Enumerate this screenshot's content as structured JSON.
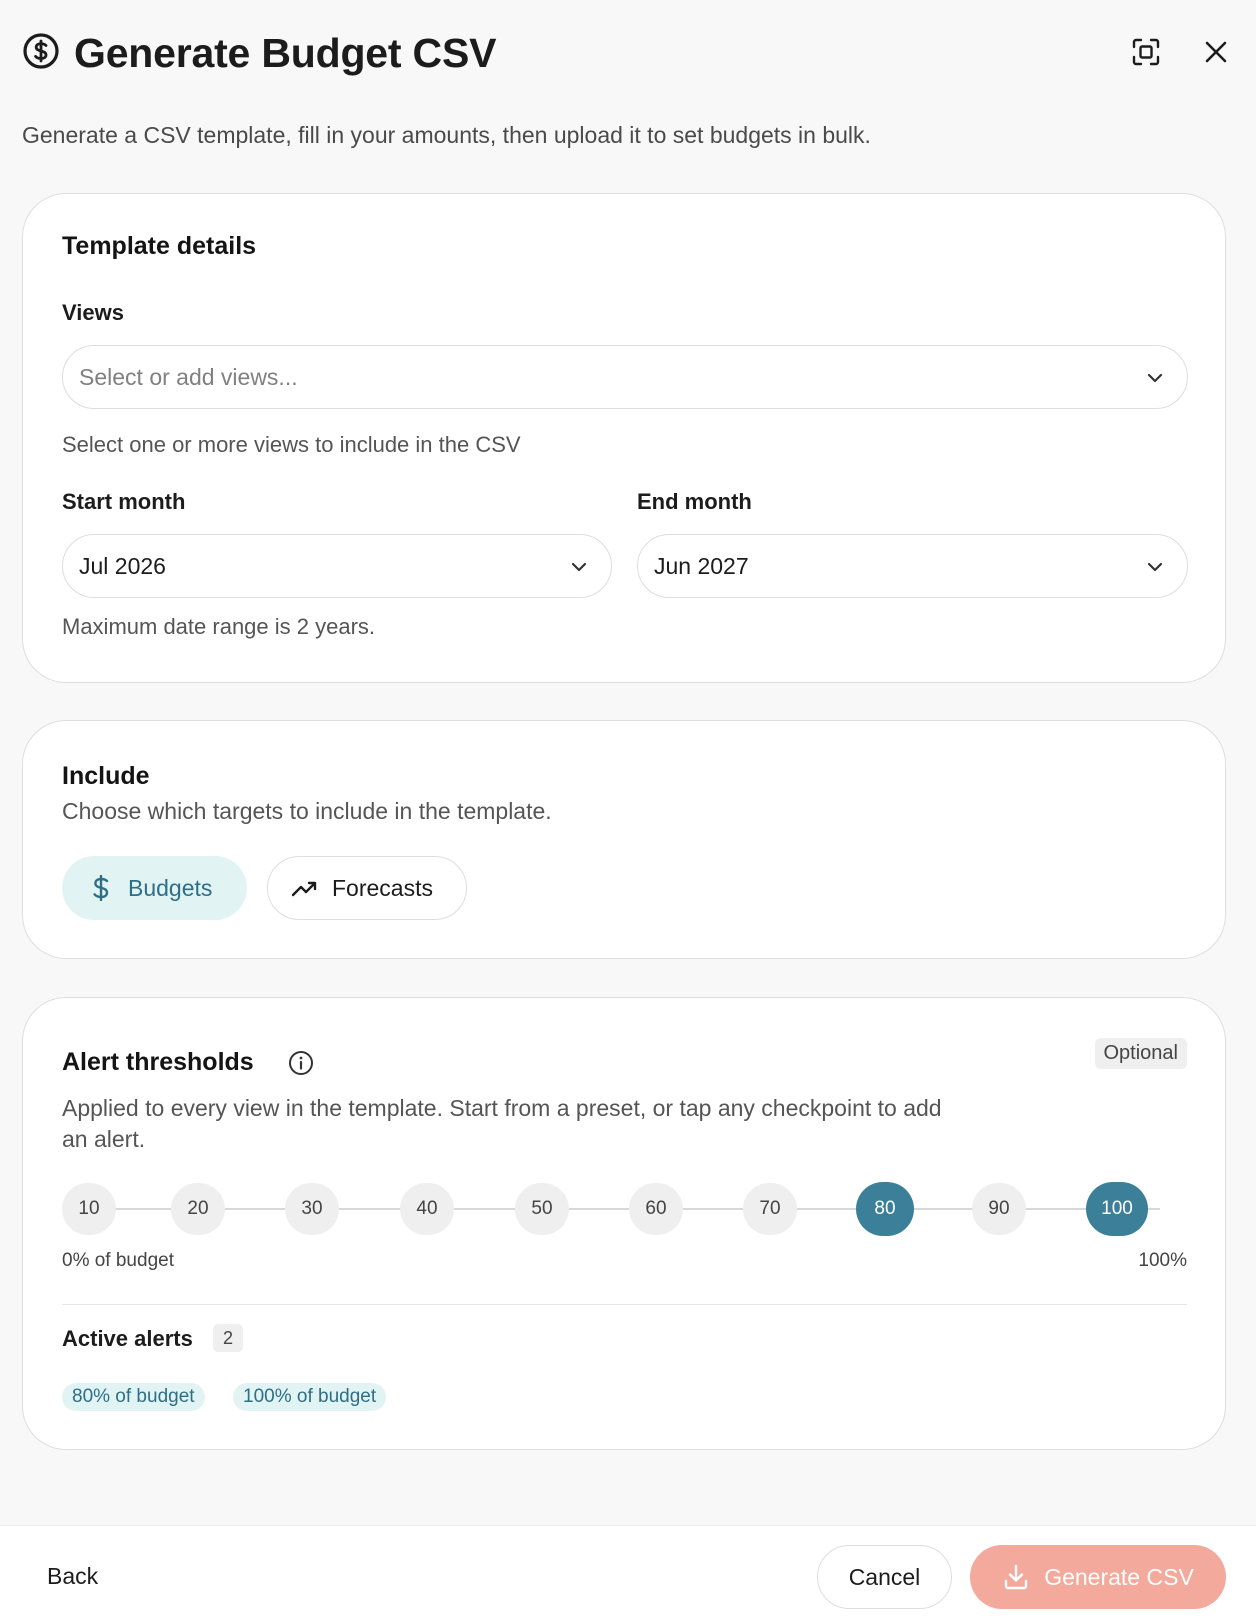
{
  "header": {
    "title": "Generate Budget CSV",
    "title_icon": "dollar-circle-icon",
    "fullscreen_icon": "fullscreen-icon",
    "close_icon": "close-icon"
  },
  "subtitle": "Generate a CSV template, fill in your amounts, then upload it to set budgets in bulk.",
  "template": {
    "title": "Template details",
    "views_label": "Views",
    "views_placeholder": "Select or add views...",
    "views_help": "Select one or more views to include in the CSV",
    "start_label": "Start month",
    "start_value": "Jul 2026",
    "end_label": "End month",
    "end_value": "Jun 2027",
    "range_help": "Maximum date range is 2 years."
  },
  "include": {
    "title": "Include",
    "description": "Choose which targets to include in the template.",
    "options": [
      {
        "label": "Budgets",
        "icon": "dollar-icon",
        "selected": true
      },
      {
        "label": "Forecasts",
        "icon": "trending-up-icon",
        "selected": false
      }
    ]
  },
  "thresholds": {
    "title": "Alert thresholds",
    "badge": "Optional",
    "description_line1": "Applied to every view in the template. Start from a preset, or tap any checkpoint to add",
    "description_line2": "an alert.",
    "steps": [
      {
        "label": "10",
        "active": false
      },
      {
        "label": "20",
        "active": false
      },
      {
        "label": "30",
        "active": false
      },
      {
        "label": "40",
        "active": false
      },
      {
        "label": "50",
        "active": false
      },
      {
        "label": "60",
        "active": false
      },
      {
        "label": "70",
        "active": false
      },
      {
        "label": "80",
        "active": true
      },
      {
        "label": "90",
        "active": false
      },
      {
        "label": "100",
        "active": true
      }
    ],
    "scale_low": "0% of budget",
    "scale_high": "100%",
    "active_title": "Active alerts",
    "active_count": "2",
    "active_chips": [
      "80% of budget",
      "100% of budget"
    ]
  },
  "footer": {
    "back": "Back",
    "cancel": "Cancel",
    "generate": "Generate CSV"
  },
  "colors": {
    "accent": "#3c7f99",
    "accent_soft": "#e2f3f4",
    "primary_disabled": "#f3a99c"
  }
}
